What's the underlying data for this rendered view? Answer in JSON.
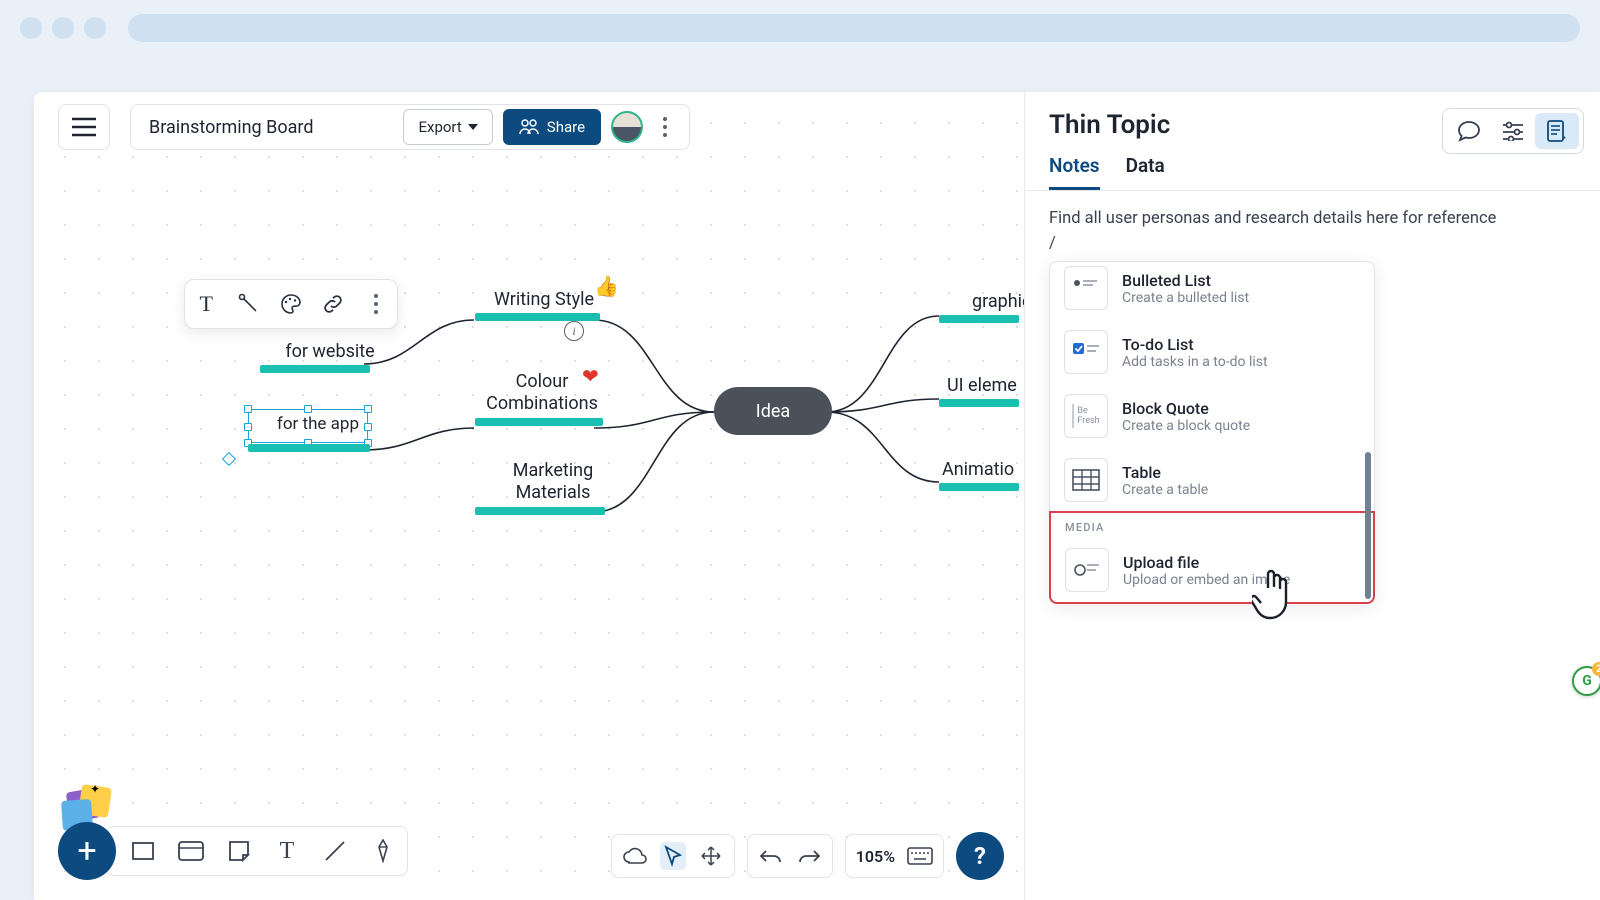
{
  "header": {
    "board_title": "Brainstorming Board",
    "export_label": "Export",
    "share_label": "Share"
  },
  "mindmap": {
    "center": "Idea",
    "left_nodes": {
      "writing_style": "Writing Style",
      "for_website": "for website",
      "for_app": "for the app",
      "colour_line1": "Colour",
      "colour_line2": "Combinations",
      "marketing_line1": "Marketing",
      "marketing_line2": "Materials"
    },
    "right_nodes": {
      "graphic": "graphic s",
      "ui": "UI eleme",
      "animation": "Animatio"
    }
  },
  "panel": {
    "title": "Thin Topic",
    "tabs": {
      "notes": "Notes",
      "data": "Data"
    },
    "note_text": "Find all user personas and research details here for reference",
    "slash": "/",
    "menu": {
      "bulleted_title": "Bulleted List",
      "bulleted_desc": "Create a bulleted list",
      "todo_title": "To-do List",
      "todo_desc": "Add tasks in a to-do list",
      "quote_title": "Block Quote",
      "quote_desc": "Create a block quote",
      "quote_icon_line1": "Be",
      "quote_icon_line2": "Fresh",
      "table_title": "Table",
      "table_desc": "Create a table",
      "media_section": "MEDIA",
      "upload_title": "Upload file",
      "upload_desc": "Upload or embed an image"
    }
  },
  "bottom": {
    "zoom": "105%",
    "help": "?"
  },
  "g_badge": "G"
}
